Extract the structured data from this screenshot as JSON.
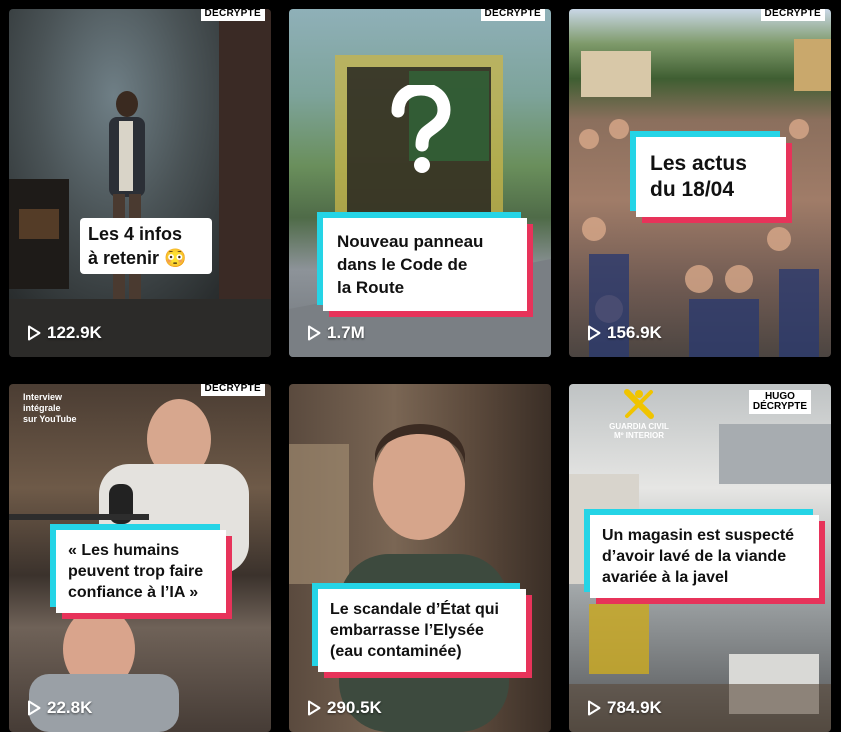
{
  "tiles": [
    {
      "badge": "DÉCRYPTE",
      "caption_line1": "Les 4 infos",
      "caption_line2": "à retenir 😳",
      "views": "122.9K"
    },
    {
      "badge": "DÉCRYPTE",
      "caption_line1": "Nouveau panneau",
      "caption_line2": "dans le Code de",
      "caption_line3": "la Route",
      "views": "1.7M",
      "overlay_symbol": "?"
    },
    {
      "badge": "DÉCRYPTE",
      "caption_line1": "Les actus",
      "caption_line2": "du 18/04",
      "views": "156.9K"
    },
    {
      "badge": "DÉCRYPTE",
      "corner_line1": "Interview",
      "corner_line2": "intégrale",
      "corner_line3": "sur YouTube",
      "caption_line1": "« Les humains",
      "caption_line2": "peuvent trop faire",
      "caption_line3": "confiance à l’IA »",
      "views": "22.8K"
    },
    {
      "caption_line1": "Le scandale d’État qui",
      "caption_line2": "embarrasse l’Elysée",
      "caption_line3": "(eau contaminée)",
      "views": "290.5K"
    },
    {
      "badge_line1": "HUGO",
      "badge_line2": "DÉCRYPTE",
      "guardia_line1": "GUARDIA CIVIL",
      "guardia_line2": "Mº INTERIOR",
      "caption_line1": "Un magasin est suspecté",
      "caption_line2": "d’avoir lavé de la viande",
      "caption_line3": "avariée à la javel",
      "views": "784.9K"
    }
  ],
  "icons": {
    "play": "play-icon",
    "views": "play-outline-icon"
  }
}
